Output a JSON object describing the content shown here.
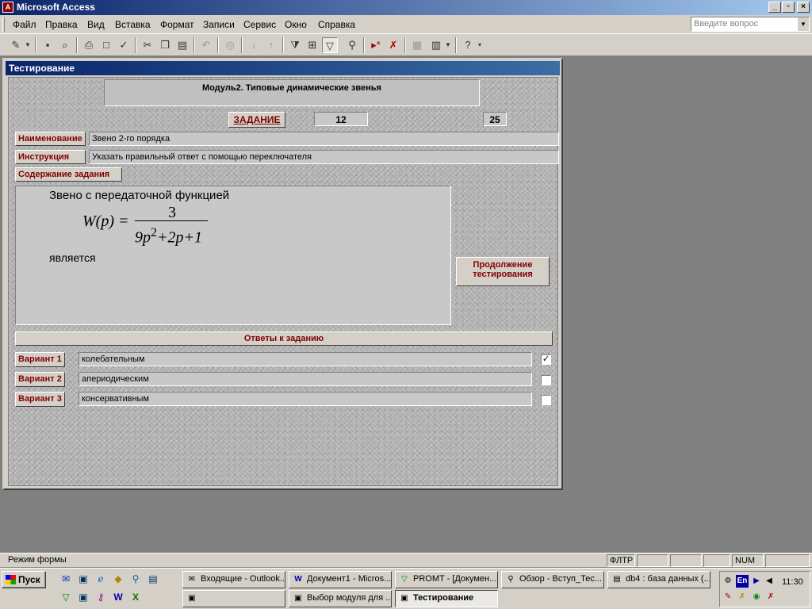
{
  "window": {
    "title": "Microsoft Access",
    "app_icon": "access-icon",
    "buttons": [
      "_",
      "▫",
      "×"
    ]
  },
  "menu": {
    "items": [
      "Файл",
      "Правка",
      "Вид",
      "Вставка",
      "Формат",
      "Записи",
      "Сервис",
      "Окно",
      "Справка"
    ],
    "help_placeholder": "Введите вопрос"
  },
  "toolbar": {
    "icons": [
      "design-view-icon",
      "save-icon",
      "search-file-icon",
      "print-icon",
      "print-preview-icon",
      "spelling-icon",
      "cut-icon",
      "copy-icon",
      "paste-icon",
      "undo-icon",
      "hyperlink-icon",
      "sort-asc-icon",
      "sort-desc-icon",
      "filter-by-selection-icon",
      "filter-by-form-icon",
      "apply-filter-icon",
      "find-icon",
      "new-record-icon",
      "delete-record-icon",
      "database-window-icon",
      "new-object-icon",
      "help-icon"
    ]
  },
  "form": {
    "title": "Тестирование",
    "module_title": "Модуль2. Типовые динамические звенья",
    "task_label": "ЗАДАНИЕ",
    "task_number": "12",
    "task_total": "25",
    "name_label": "Наименование",
    "name_value": "Звено 2-го порядка",
    "instruction_label": "Инструкция",
    "instruction_value": "Указать правильный ответ с помощью переключателя",
    "content_label": "Содержание задания",
    "content": {
      "intro": "Звено с передаточной функцией",
      "formula_lhs": "W(p) =",
      "formula_numerator": "3",
      "formula_denominator_a": "9p",
      "formula_denominator_exp": "2",
      "formula_denominator_b": "+2p+1",
      "outro": "является"
    },
    "continue_button": "Продолжение тестирования",
    "answers_header": "Ответы к заданию",
    "variants": [
      {
        "label": "Вариант 1",
        "value": "колебательным",
        "checked": "✓"
      },
      {
        "label": "Вариант 2",
        "value": "апериодическим",
        "checked": ""
      },
      {
        "label": "Вариант 3",
        "value": "консервативным",
        "checked": ""
      }
    ]
  },
  "status": {
    "mode": "Режим формы",
    "filter": "ФЛТР",
    "num": "NUM"
  },
  "taskbar": {
    "start": "Пуск",
    "tasks": [
      {
        "label": "Входящие - Outlook...",
        "icon": "outlook-icon"
      },
      {
        "label": "Документ1 - Micros...",
        "icon": "word-icon"
      },
      {
        "label": "PROMT - [Докумен...",
        "icon": "promt-icon"
      },
      {
        "label": "Обзор - Вступ_Тес...",
        "icon": "explorer-icon"
      },
      {
        "label": "db4 : база данных (...",
        "icon": "database-icon"
      },
      {
        "label": "",
        "icon": "form-icon"
      },
      {
        "label": "Выбор модуля для ...",
        "icon": "form-icon"
      },
      {
        "label": "Тестирование",
        "icon": "form-icon"
      }
    ],
    "tray_language": "En",
    "clock": "11:30"
  }
}
